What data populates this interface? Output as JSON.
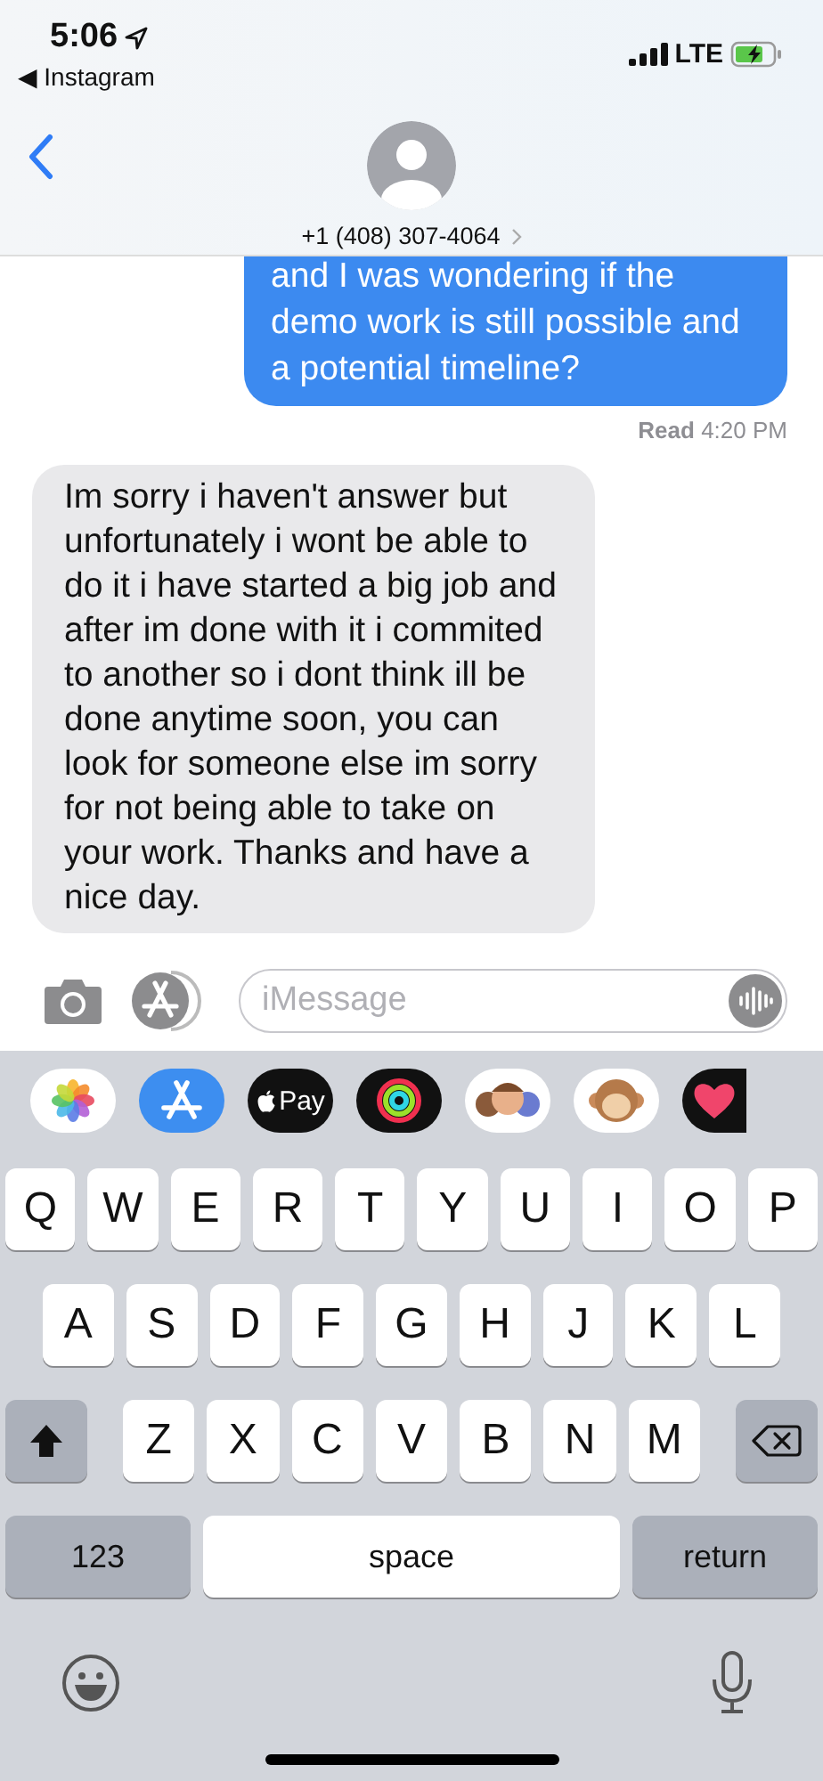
{
  "status_bar": {
    "time": "5:06",
    "back_app": "◀ Instagram",
    "network": "LTE"
  },
  "header": {
    "contact": "+1 (408) 307-4064"
  },
  "messages": [
    {
      "kind": "sent",
      "text": "and I was wondering if the demo work is still possible and a potential timeline?"
    },
    {
      "kind": "receipt",
      "text": "**Read** 4:20 PM"
    },
    {
      "kind": "received",
      "text": "Im sorry i haven't answer but unfortunately i wont be able to do it i have started a big job and after im done with it i commited to another so i dont think ill be done anytime soon, you can look for someone else im sorry for not being able to take on your work. Thanks and have a nice day."
    }
  ],
  "compose": {
    "placeholder": "iMessage"
  },
  "app_strip": {
    "pay_label": "Pay"
  },
  "keyboard": {
    "rows": [
      [
        "Q",
        "W",
        "E",
        "R",
        "T",
        "Y",
        "U",
        "I",
        "O",
        "P"
      ],
      [
        "A",
        "S",
        "D",
        "F",
        "G",
        "H",
        "J",
        "K",
        "L"
      ],
      [
        "Z",
        "X",
        "C",
        "V",
        "B",
        "N",
        "M"
      ]
    ],
    "numbers_key": "123",
    "space_key": "space",
    "return_key": "return"
  }
}
